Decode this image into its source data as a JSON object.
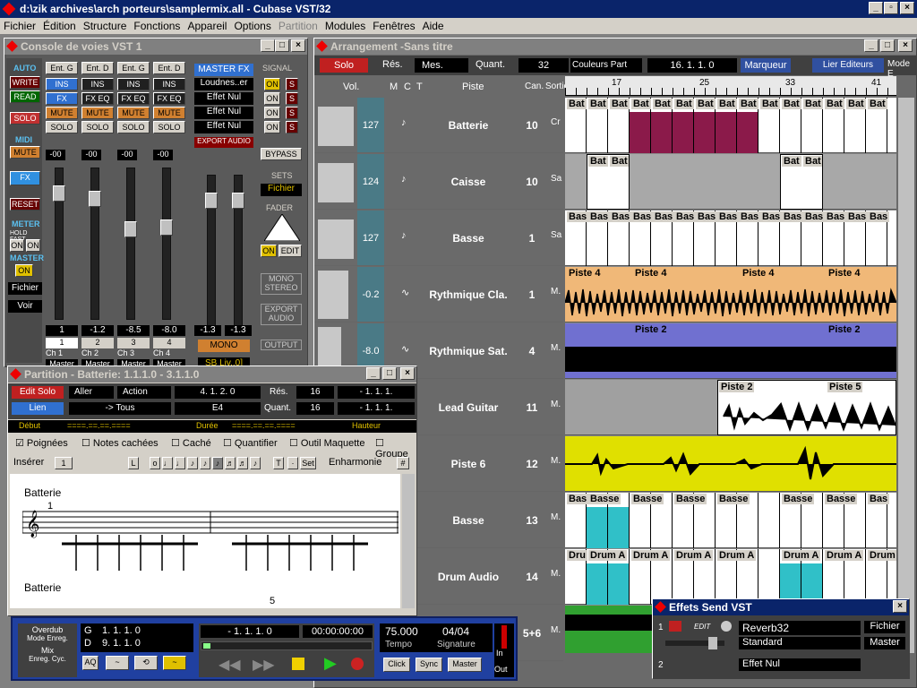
{
  "app": {
    "title": "d:\\zik archives\\arch porteurs\\samplermix.all - Cubase VST/32"
  },
  "menu": [
    "Fichier",
    "Édition",
    "Structure",
    "Fonctions",
    "Appareil",
    "Options",
    "Partition",
    "Modules",
    "Fenêtres",
    "Aide"
  ],
  "console": {
    "title": "Console de voies VST 1",
    "left": {
      "auto": "AUTO",
      "write": "WRITE",
      "read": "READ",
      "solo": "SOLO",
      "midi": "MIDI",
      "mute": "MUTE",
      "fx": "FX",
      "reset": "RESET",
      "meter": "METER",
      "holdfast": "HOLD FAST",
      "on": "ON",
      "master": "MASTER",
      "fichier": "Fichier",
      "voir": "Voir"
    },
    "channels": [
      {
        "ent": "Ent. G",
        "ins": "INS",
        "fx": "FX",
        "mute": "MUTE",
        "solo": "SOLO",
        "val": "-00",
        "db": "1",
        "num": "1",
        "name": "Ch 1",
        "out": "Master"
      },
      {
        "ent": "Ent. D",
        "ins": "INS",
        "fx": "FX EQ",
        "mute": "MUTE",
        "solo": "SOLO",
        "val": "-00",
        "db": "-1.2",
        "num": "2",
        "name": "Ch 2",
        "out": "Master"
      },
      {
        "ent": "Ent. G",
        "ins": "INS",
        "fx": "FX EQ",
        "mute": "MUTE",
        "solo": "SOLO",
        "val": "-00",
        "db": "-8.5",
        "num": "3",
        "name": "Ch 3",
        "out": "Master"
      },
      {
        "ent": "Ent. D",
        "ins": "INS",
        "fx": "FX EQ",
        "mute": "MUTE",
        "solo": "SOLO",
        "val": "-00",
        "db": "-8.0",
        "num": "4",
        "name": "Ch 4",
        "out": "Master"
      }
    ],
    "masterfx": {
      "title": "MASTER FX",
      "slots": [
        "Loudnes..er",
        "Effet Nul",
        "Effet Nul",
        "Effet Nul"
      ],
      "export": "EXPORT AUDIO",
      "left_db": "-1.3",
      "right_db": "-1.3",
      "mono": "MONO",
      "out": "SB Liv..0]"
    },
    "right": {
      "signal": "SIGNAL",
      "on": "ON",
      "s": "S",
      "bypass": "BYPASS",
      "sets": "SETS",
      "fichier": "Fichier",
      "fader": "FADER",
      "edit": "EDIT",
      "monostereo": "MONO STEREO",
      "export": "EXPORT AUDIO",
      "output": "OUTPUT"
    }
  },
  "arrangement": {
    "title": "Arrangement -Sans titre",
    "toolbar": {
      "solo": "Solo",
      "res": "Rés.",
      "mes": "Mes.",
      "quant": "Quant.",
      "quant_val": "32",
      "couleurs": "Couleurs Part",
      "pos": "16. 1. 1.     0",
      "marqueur": "Marqueur",
      "liereditors": "Lier Editeurs",
      "mode": "Mode E"
    },
    "headers": {
      "vol": "Vol.",
      "m": "M",
      "c": "C",
      "t": "T",
      "piste": "Piste",
      "can": "Can.",
      "sortie": "Sortie"
    },
    "ruler": [
      "17",
      "25",
      "33",
      "41"
    ],
    "tracks": [
      {
        "vol": "127",
        "name": "Batterie",
        "ch": "10",
        "out": "Cr",
        "type": "♪"
      },
      {
        "vol": "124",
        "name": "Caisse",
        "ch": "10",
        "out": "Sa",
        "type": "♪"
      },
      {
        "vol": "127",
        "name": "Basse",
        "ch": "1",
        "out": "Sa",
        "type": "♪"
      },
      {
        "vol": "-0.2",
        "name": "Rythmique Cla.",
        "ch": "1",
        "out": "M.",
        "type": "∿"
      },
      {
        "vol": "-8.0",
        "name": "Rythmique Sat.",
        "ch": "4",
        "out": "M.",
        "type": "∿"
      },
      {
        "vol": "",
        "name": "Lead Guitar",
        "ch": "11",
        "out": "M.",
        "type": ""
      },
      {
        "vol": "",
        "name": "Piste 6",
        "ch": "12",
        "out": "M.",
        "type": ""
      },
      {
        "vol": "",
        "name": "Basse",
        "ch": "13",
        "out": "M.",
        "type": ""
      },
      {
        "vol": "",
        "name": "Drum Audio",
        "ch": "14",
        "out": "M.",
        "type": ""
      },
      {
        "vol": "",
        "name": "",
        "ch": "5+6",
        "out": "M.",
        "type": ""
      }
    ],
    "parts": {
      "bat": "Bat",
      "basse_short": "Bas",
      "basse": "Basse",
      "piste4": "Piste 4",
      "piste2": "Piste 2",
      "piste5": "Piste 5",
      "drum": "Drum A",
      "drum_short": "Dru",
      "drum_full": "Drum"
    }
  },
  "partition": {
    "title": "Partition - Batterie:  1.1.1.0 - 3.1.1.0",
    "editsolo": "Edit Solo",
    "aller": "Aller",
    "action": "Action",
    "pos1": "4.  1.  2.    0",
    "res": "Rés.",
    "res_val": "16",
    "pos2": "-   1.  1.  1.",
    "lien": "Lien",
    "tous": "-> Tous",
    "note": "E4",
    "quant": "Quant.",
    "quant_val": "16",
    "pos3": "-   1.  1.  1.",
    "debut": "Début",
    "debut_val": "====.==.==.====",
    "duree": "Durée",
    "duree_val": "====.==.==.====",
    "hauteur": "Hauteur",
    "checks": [
      "Poignées",
      "Notes cachées",
      "Caché",
      "Quantifier",
      "Outil Maquette",
      "Groupe"
    ],
    "inserer": "Insérer",
    "inserer_val": "1",
    "set": "Set",
    "enharmonie": "Enharmonie",
    "staff1": "Batterie",
    "staff2": "Batterie",
    "bar1": "1",
    "bar5": "5"
  },
  "transport": {
    "overdub": "Overdub",
    "mode": "Mode Enreg.",
    "mix": "Mix",
    "cycle": "Enreg. Cyc.",
    "g": "G",
    "d": "D",
    "gpos": "1.  1.  1.     0",
    "dpos": "9.  1.  1.     0",
    "songpos": "-  1.  1.  1.     0",
    "time": "00:00:00:00",
    "tempo_val": "75.000",
    "sig_val": "04/04",
    "tempo": "Tempo",
    "signature": "Signature",
    "aq": "AQ",
    "click": "Click",
    "sync": "Sync",
    "master": "Master",
    "in": "In",
    "out": "Out"
  },
  "effets": {
    "title": "Effets Send VST",
    "slot1": "1",
    "edit": "EDIT",
    "plugin": "Reverb32",
    "preset": "Standard",
    "fichier": "Fichier",
    "master": "Master",
    "slot2": "2",
    "effet2": "Effet Nul"
  },
  "colors": {
    "titlebar": "#0a246a",
    "maroon": "#8b1a4a",
    "orange": "#f0b878",
    "purple": "#7070d0",
    "yellow": "#e0e000",
    "cyan": "#30c0c8",
    "green": "#30a030"
  }
}
